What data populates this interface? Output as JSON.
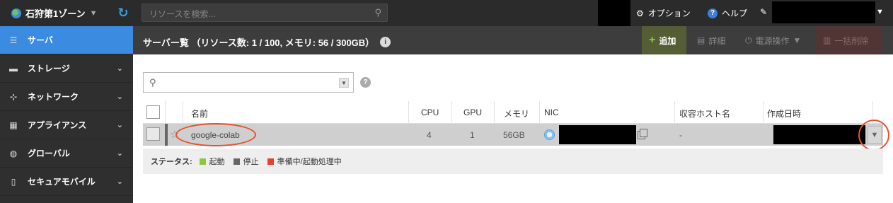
{
  "topbar": {
    "zone_label": "石狩第1ゾーン",
    "search_placeholder": "リソースを検索...",
    "options_label": "オプション",
    "help_label": "ヘルプ"
  },
  "sidebar": {
    "items": [
      {
        "label": "サーバ",
        "icon": "server-icon",
        "active": true
      },
      {
        "label": "ストレージ",
        "icon": "storage-icon"
      },
      {
        "label": "ネットワーク",
        "icon": "network-icon"
      },
      {
        "label": "アプライアンス",
        "icon": "grid-icon"
      },
      {
        "label": "グローバル",
        "icon": "globe-icon"
      },
      {
        "label": "セキュアモバイル",
        "icon": "mobile-icon"
      }
    ]
  },
  "header": {
    "title": "サーバー覧 （リソース数: 1 / 100, メモリ: 56 / 300GB）",
    "add_label": "追加",
    "detail_label": "詳細",
    "power_label": "電源操作",
    "bulk_delete_label": "一括削除"
  },
  "table": {
    "columns": [
      "名前",
      "CPU",
      "GPU",
      "メモリ",
      "NIC",
      "収容ホスト名",
      "作成日時"
    ],
    "rows": [
      {
        "name": "google-colab",
        "cpu": "4",
        "gpu": "1",
        "memory": "56GB",
        "host": "-"
      }
    ]
  },
  "legend": {
    "label": "ステータス:",
    "items": [
      {
        "label": "起動",
        "color": "#8dc63f"
      },
      {
        "label": "停止",
        "color": "#666666"
      },
      {
        "label": "準備中/起動処理中",
        "color": "#e8402a"
      }
    ]
  }
}
